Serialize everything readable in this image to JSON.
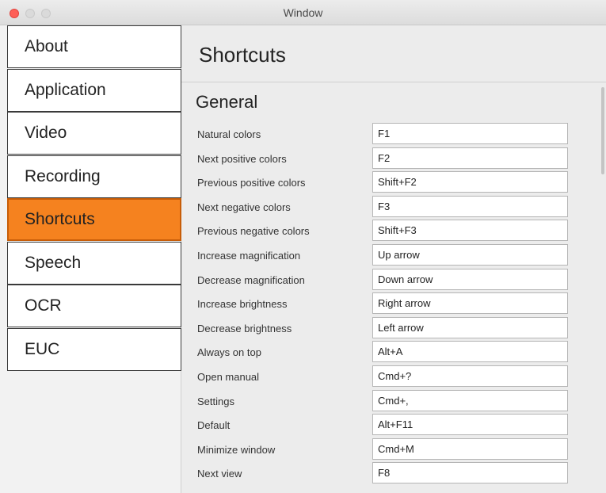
{
  "window": {
    "title": "Window"
  },
  "sidebar": {
    "items": [
      {
        "label": "About",
        "name": "sidebar-item-about",
        "active": false
      },
      {
        "label": "Application",
        "name": "sidebar-item-application",
        "active": false
      },
      {
        "label": "Video",
        "name": "sidebar-item-video",
        "active": false
      },
      {
        "label": "Recording",
        "name": "sidebar-item-recording",
        "active": false
      },
      {
        "label": "Shortcuts",
        "name": "sidebar-item-shortcuts",
        "active": true
      },
      {
        "label": "Speech",
        "name": "sidebar-item-speech",
        "active": false
      },
      {
        "label": "OCR",
        "name": "sidebar-item-ocr",
        "active": false
      },
      {
        "label": "EUC",
        "name": "sidebar-item-euc",
        "active": false
      }
    ]
  },
  "main": {
    "title": "Shortcuts",
    "section": "General",
    "shortcuts": [
      {
        "label": "Natural colors",
        "value": "F1"
      },
      {
        "label": "Next positive colors",
        "value": "F2"
      },
      {
        "label": "Previous positive colors",
        "value": "Shift+F2"
      },
      {
        "label": "Next negative colors",
        "value": "F3"
      },
      {
        "label": "Previous negative colors",
        "value": "Shift+F3"
      },
      {
        "label": "Increase magnification",
        "value": "Up arrow"
      },
      {
        "label": "Decrease magnification",
        "value": "Down arrow"
      },
      {
        "label": "Increase brightness",
        "value": "Right arrow"
      },
      {
        "label": "Decrease brightness",
        "value": "Left arrow"
      },
      {
        "label": "Always on top",
        "value": "Alt+A"
      },
      {
        "label": "Open manual",
        "value": "Cmd+?"
      },
      {
        "label": "Settings",
        "value": "Cmd+,"
      },
      {
        "label": "Default",
        "value": "Alt+F11"
      },
      {
        "label": "Minimize window",
        "value": "Cmd+M"
      },
      {
        "label": "Next view",
        "value": "F8"
      }
    ]
  },
  "colors": {
    "accent": "#f5821f",
    "close_button": "#fe5f57"
  }
}
